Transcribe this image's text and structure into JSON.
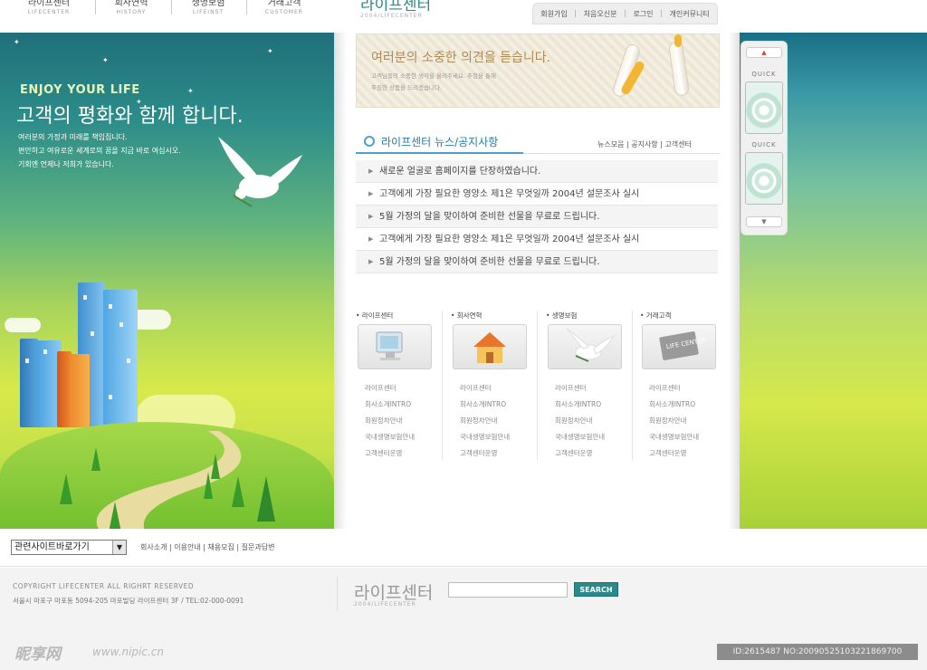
{
  "topnav": {
    "items": [
      {
        "label": "라이프센터",
        "sub": "LIFECENTER"
      },
      {
        "label": "회사연혁",
        "sub": "HISTORY"
      },
      {
        "label": "생명보험",
        "sub": "LIFEINST"
      },
      {
        "label": "거래고객",
        "sub": "CUSTOMER"
      }
    ]
  },
  "logo": {
    "title": "라이프센터",
    "sub": "2004/LIFECENTER"
  },
  "util": [
    "회원가입",
    "처음오신분",
    "로그인",
    "개인커뮤니티"
  ],
  "banner": {
    "eng": "ENJOY YOUR LIFE",
    "headline": "고객의 평화와 함께 합니다.",
    "desc": [
      "여러분의 가정과 미래를 책임집니다.",
      "편안하고 여유로운 세계로의 꿈을 지금 바로 여십시오.",
      "기회엔 언제나 저희가 있습니다."
    ]
  },
  "opinion": {
    "title": "여러분의 소중한 의견을 듣습니다.",
    "lines": [
      "고객님들의 소중한 생각을 올려주세요. 추첨을 통해",
      "푸짐한 상품을 드리겠습니다."
    ]
  },
  "quick": {
    "label1": "QUICK",
    "label2": "QUICK"
  },
  "news": {
    "title": "라이프센터 뉴스/공지사항",
    "links": "뉴스모음 | 공지사항 | 고객센터",
    "items": [
      "새로운 얼굴로 홈페이지를 단장하였습니다.",
      "고객에게 가장 필요한 영양소 제1은 무엇일까 2004년 설문조사 실시",
      "5월 가정의 달을 맞이하여 준비한 선물을 무료로 드립니다.",
      "고객에게 가장 필요한 영양소 제1은 무엇일까 2004년 설문조사 실시",
      "5월 가정의 달을 맞이하여 준비한 선물을 무료로 드립니다."
    ]
  },
  "cats": [
    {
      "title": "• 라이프센터",
      "links": [
        "라이프센터",
        "회사소개INTRO",
        "회원정차안내",
        "국내생명보험안내",
        "고객센터운영"
      ]
    },
    {
      "title": "• 회사연혁",
      "links": [
        "라이프센터",
        "회사소개INTRO",
        "회원정차안내",
        "국내생명보험안내",
        "고객센터운영"
      ]
    },
    {
      "title": "• 생명보험",
      "links": [
        "라이프센터",
        "회사소개INTRO",
        "회원정차안내",
        "국내생명보험안내",
        "고객센터운영"
      ]
    },
    {
      "title": "• 거래고객",
      "links": [
        "라이프센터",
        "회사소개INTRO",
        "회원정차안내",
        "국내생명보험안내",
        "고객센터운영"
      ]
    }
  ],
  "cat_icon_text": "LIFE CENTER",
  "footer": {
    "select": "관련사이트바로가기",
    "links": "회사소개 | 이용안내 | 채용모집 | 질문과답변",
    "copyright": "COPYRIGHT LIFECENTER ALL RIGHRT RESERVED",
    "address": "서울시 마포구 마포동 5094-205 마포빌딩 라이프센터 3F /   TEL:02-000-0091",
    "logo": "라이프센터",
    "logo_sub": "2004/LIFECENTER",
    "search_btn": "SEARCH"
  },
  "watermark": {
    "logo": "昵享网",
    "url": "www.nipic.cn",
    "id": "ID:2615487 NO:20090525103221869700"
  }
}
